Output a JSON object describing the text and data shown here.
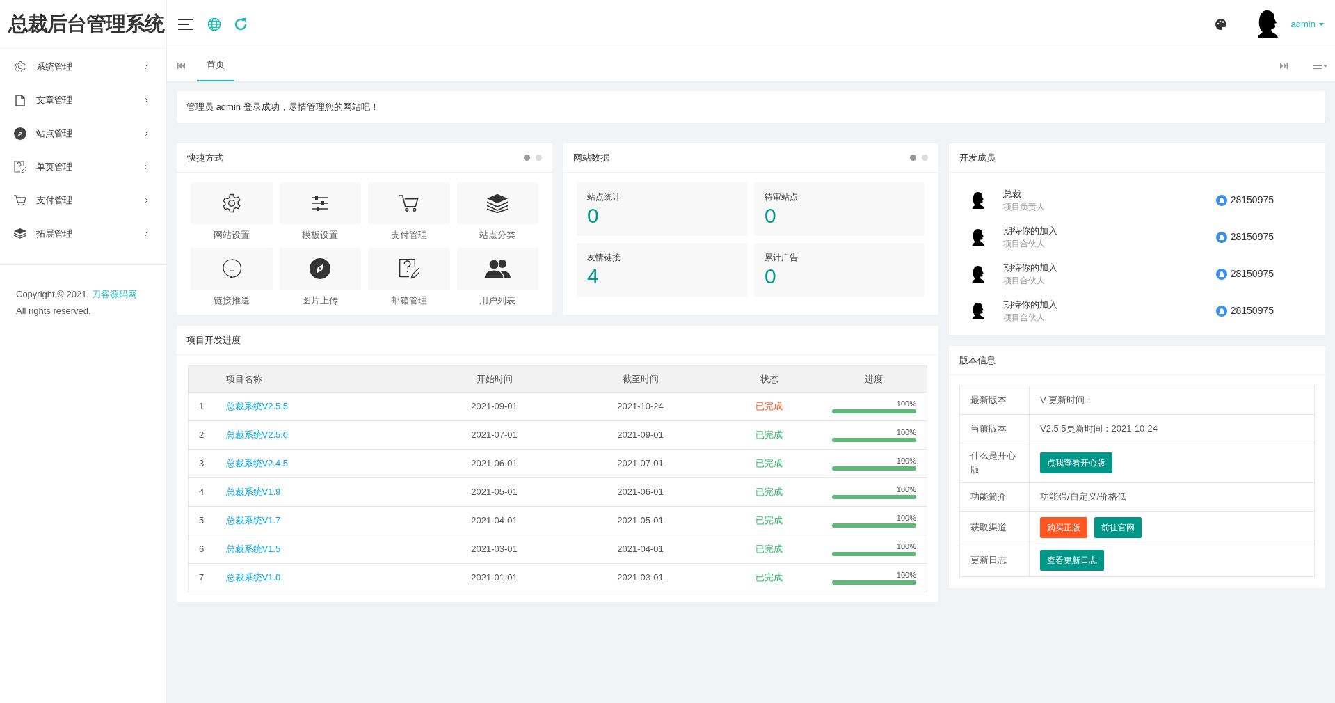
{
  "brand": {
    "title": "总裁后台管理系统"
  },
  "header": {
    "user": "admin"
  },
  "sidebar": {
    "items": [
      {
        "label": "系统管理",
        "expanded": false
      },
      {
        "label": "文章管理",
        "expanded": false
      },
      {
        "label": "站点管理",
        "expanded": false
      },
      {
        "label": "单页管理",
        "expanded": false
      },
      {
        "label": "支付管理",
        "expanded": false
      },
      {
        "label": "拓展管理",
        "expanded": false
      }
    ],
    "copyright": {
      "text": "Copyright © 2021.",
      "link": "刀客源码网",
      "rights": "All rights reserved."
    }
  },
  "tabs": [
    {
      "label": "首页",
      "selected": true
    }
  ],
  "notice": "管理员 admin 登录成功，尽情管理您的网站吧！",
  "shortcuts": {
    "title": "快捷方式",
    "pager": [
      {
        "selected": true
      },
      {
        "selected": false
      }
    ],
    "items": [
      "网站设置",
      "模板设置",
      "支付管理",
      "站点分类",
      "链接推送",
      "图片上传",
      "邮箱管理",
      "用户列表"
    ]
  },
  "site_data": {
    "title": "网站数据",
    "pager": [
      {
        "selected": true
      },
      {
        "selected": false
      }
    ],
    "stats": [
      {
        "label": "站点统计",
        "value": "0"
      },
      {
        "label": "待审站点",
        "value": "0"
      },
      {
        "label": "友情链接",
        "value": "4"
      },
      {
        "label": "累计广告",
        "value": "0"
      }
    ]
  },
  "members": {
    "title": "开发成员",
    "items": [
      {
        "name": "总裁",
        "role": "项目负责人",
        "qq": "28150975"
      },
      {
        "name": "期待你的加入",
        "role": "项目合伙人",
        "qq": "28150975"
      },
      {
        "name": "期待你的加入",
        "role": "项目合伙人",
        "qq": "28150975"
      },
      {
        "name": "期待你的加入",
        "role": "项目合伙人",
        "qq": "28150975"
      }
    ]
  },
  "progress": {
    "title": "项目开发进度",
    "columns": [
      "项目名称",
      "开始时间",
      "截至时间",
      "状态",
      "进度"
    ],
    "rows": [
      {
        "index": "1",
        "name": "总裁系统V2.5.5",
        "start": "2021-09-01",
        "end": "2021-10-24",
        "status": "已完成",
        "highlight": true,
        "level": 1,
        "percent": "100%"
      },
      {
        "index": "2",
        "name": "总裁系统V2.5.0",
        "start": "2021-07-01",
        "end": "2021-09-01",
        "status": "已完成",
        "highlight": false,
        "level": 1,
        "percent": "100%"
      },
      {
        "index": "3",
        "name": "总裁系统V2.4.5",
        "start": "2021-06-01",
        "end": "2021-07-01",
        "status": "已完成",
        "highlight": false,
        "level": 1,
        "percent": "100%"
      },
      {
        "index": "4",
        "name": "总裁系统V1.9",
        "start": "2021-05-01",
        "end": "2021-06-01",
        "status": "已完成",
        "highlight": false,
        "level": 1,
        "percent": "100%"
      },
      {
        "index": "5",
        "name": "总裁系统V1.7",
        "start": "2021-04-01",
        "end": "2021-05-01",
        "status": "已完成",
        "highlight": false,
        "level": 1,
        "percent": "100%"
      },
      {
        "index": "6",
        "name": "总裁系统V1.5",
        "start": "2021-03-01",
        "end": "2021-04-01",
        "status": "已完成",
        "highlight": false,
        "level": 1,
        "percent": "100%"
      },
      {
        "index": "7",
        "name": "总裁系统V1.0",
        "start": "2021-01-01",
        "end": "2021-03-01",
        "status": "已完成",
        "highlight": false,
        "level": 1,
        "percent": "100%"
      }
    ]
  },
  "version": {
    "title": "版本信息",
    "rows": [
      {
        "kind": "text",
        "label": "最新版本",
        "value": "V 更新时间："
      },
      {
        "kind": "text",
        "label": "当前版本",
        "value": "V2.5.5更新时间：2021-10-24"
      },
      {
        "kind": "buttons",
        "label": "什么是开心版",
        "buttons": [
          {
            "label": "点我查看开心版",
            "color": "#009688"
          }
        ]
      },
      {
        "kind": "text",
        "label": "功能简介",
        "value": "功能强/自定义/价格低"
      },
      {
        "kind": "buttons",
        "label": "获取渠道",
        "buttons": [
          {
            "label": "购买正版",
            "color": "#ff5722"
          },
          {
            "label": "前往官网",
            "color": "#009688"
          }
        ]
      },
      {
        "kind": "buttons",
        "label": "更新日志",
        "buttons": [
          {
            "label": "查看更新日志",
            "color": "#009688"
          }
        ]
      }
    ]
  }
}
